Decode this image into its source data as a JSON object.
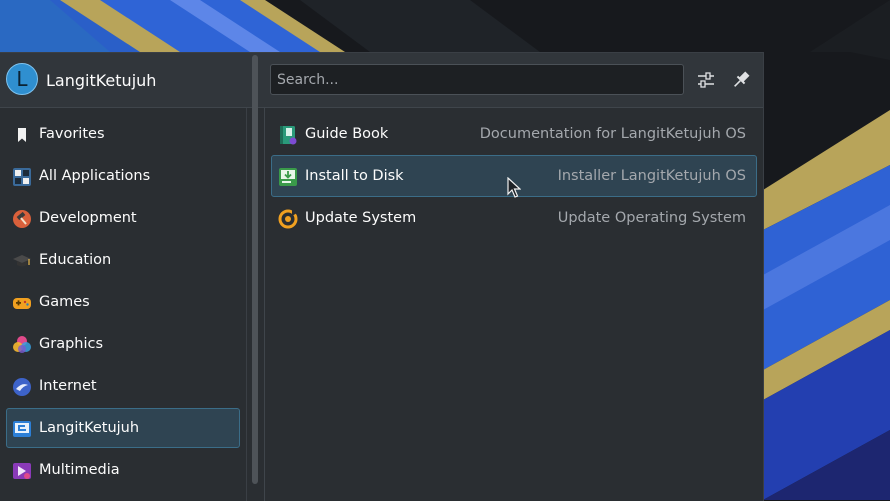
{
  "user": {
    "avatar_letter": "L",
    "name": "LangitKetujuh"
  },
  "search": {
    "placeholder": "Search..."
  },
  "header_buttons": [
    {
      "icon": "configure-icon"
    },
    {
      "icon": "pin-icon"
    }
  ],
  "categories": [
    {
      "label": "Favorites",
      "icon": "bookmark-icon"
    },
    {
      "label": "All Applications",
      "icon": "all-applications-icon"
    },
    {
      "label": "Development",
      "icon": "hammer-icon"
    },
    {
      "label": "Education",
      "icon": "graduation-cap-icon"
    },
    {
      "label": "Games",
      "icon": "gamepad-icon"
    },
    {
      "label": "Graphics",
      "icon": "graphics-icon"
    },
    {
      "label": "Internet",
      "icon": "internet-icon"
    },
    {
      "label": "LangitKetujuh",
      "icon": "langitketujuh-icon",
      "selected": true
    },
    {
      "label": "Multimedia",
      "icon": "multimedia-icon"
    }
  ],
  "apps": [
    {
      "name": "Guide Book",
      "description": "Documentation for LangitKetujuh OS",
      "icon": "guide-book-icon"
    },
    {
      "name": "Install to Disk",
      "description": "Installer LangitKetujuh OS",
      "icon": "install-disk-icon",
      "selected": true
    },
    {
      "name": "Update System",
      "description": "Update Operating System",
      "icon": "update-system-icon"
    }
  ],
  "colors": {
    "panel_bg": "#2a2e32",
    "header_bg": "#31363b",
    "selection_bg": "#2f4452",
    "selection_border": "#3b6d88",
    "secondary_text": "#a4a8ad",
    "wallpaper_blue": "#3a63d8",
    "wallpaper_gold": "#b0a054"
  }
}
